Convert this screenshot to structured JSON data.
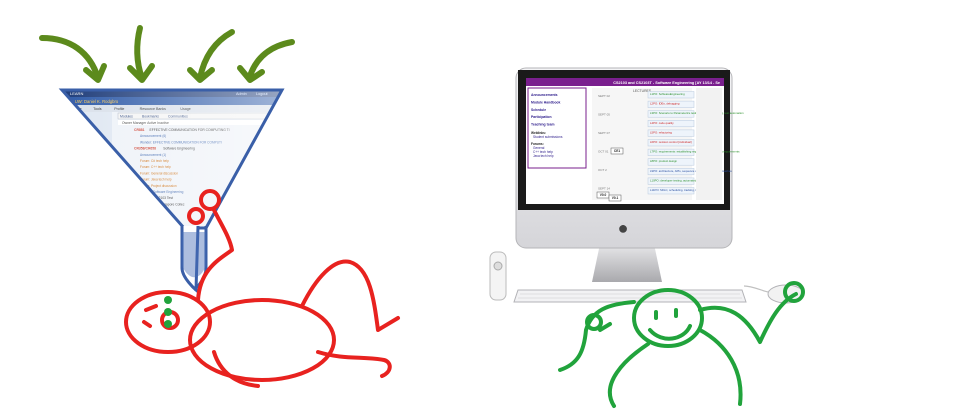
{
  "left_screen": {
    "top_bar_left": "LEARN",
    "top_bar_right_1": "Admin",
    "top_bar_right_2": "Logout",
    "user_title": "My UW: Daniel K. Rodgbro",
    "menu": [
      "Course",
      "Tools",
      "Profile",
      "Resource Banks",
      "Usage"
    ],
    "tabs": [
      "Modules",
      "Bookmarks",
      "Communities"
    ],
    "filter_row": "Owner   Manager   Active   Inactive",
    "tree": [
      {
        "code": "CR881",
        "text": "EFFECTIVE COMMUNICATION FOR COMPUTING TI"
      },
      {
        "code": "",
        "text": "Announcement (6)"
      },
      {
        "code": "",
        "text": "Wonder: EFFECTIVE COMMUNICATION FOR COMPUTI"
      },
      {
        "code": "CR358/CR658",
        "text": "Software Engineering"
      },
      {
        "code": "",
        "text": "Announcement (1)"
      },
      {
        "code": "",
        "text": "Forum: C# tech help"
      },
      {
        "code": "",
        "text": "Forum: C++ tech help"
      },
      {
        "code": "",
        "text": "Forum: General discussion"
      },
      {
        "code": "",
        "text": "Forum: Java tech help"
      },
      {
        "code": "",
        "text": "Forum: Project discussion"
      },
      {
        "code": "",
        "text": "Wonder: Software Engineering"
      },
      {
        "code": "CRS2106",
        "text": "CS2103 Test"
      },
      {
        "code": "CR2102",
        "text": "NC3 Singapore Collec"
      },
      {
        "code": "",
        "text": "Chelf's: active wel"
      }
    ]
  },
  "mac_screen": {
    "banner": "CS2103 and CS2103T - Software Engineering [AY 13/14 - Se",
    "nav_links": [
      "Announcements",
      "Module Handbook",
      "Schedule",
      "Participation",
      "Teaching team"
    ],
    "weblinks_heading": "Weblinks:",
    "weblinks": [
      "Student submissions"
    ],
    "forums_heading": "Forums:",
    "forums": [
      "General",
      "C++ tech help",
      "Java tech help"
    ],
    "lectures_heading": "LECTURES",
    "week_markers": [
      "SEPT 02",
      "SEPT 05",
      "SEPT 07",
      "OCT 01",
      "OCT 2",
      "SEPT 14"
    ],
    "markers": [
      "CE1",
      "V0.0",
      "V0.1"
    ],
    "lectures": [
      {
        "label": "L1PO: SoftwareEngineering",
        "color": "#2a8f2a"
      },
      {
        "label": "L2PO: IDEs, debugging",
        "color": "#cc2222"
      },
      {
        "label": "L3PO: Scenario to Parameterize testing, regression testing, test automation",
        "color": "#2a8f2a"
      },
      {
        "label": "L4PO: code quality",
        "color": "#cc2222"
      },
      {
        "label": "L5PO: refactoring",
        "color": "#cc2222"
      },
      {
        "label": "L6PO: revision control [individual]",
        "color": "#cc2222"
      },
      {
        "label": "L7PO: requirements: establishing requirements, specifying requirements",
        "color": "#2a8f2a"
      },
      {
        "label": "L8PO: product design",
        "color": "#2a8f2a"
      },
      {
        "label": "L9PO: architecture, APIs, sequence diagrams, design approaches",
        "color": "#2a4fa0"
      },
      {
        "label": "L10PO: developer testing, automated GUI testing, TDD",
        "color": "#2a8f2a"
      },
      {
        "label": "L11PO: SDLC, scheduling, tracking, team structures",
        "color": "#2a4fa0"
      }
    ]
  },
  "colors": {
    "arrow_green": "#5c8a1c",
    "funnel_blue": "#3a5fa8",
    "figure_red": "#e8221f",
    "figure_green": "#21a33c",
    "mac_purple": "#7a1f8e"
  }
}
